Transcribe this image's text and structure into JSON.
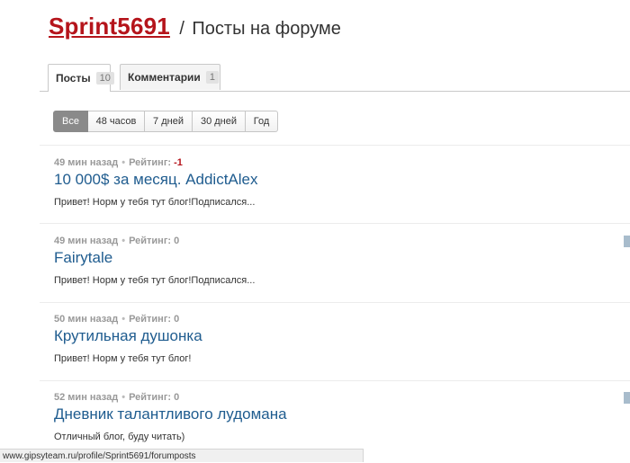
{
  "header": {
    "username": "Sprint5691",
    "separator": "/",
    "title": "Посты на форуме"
  },
  "tabs": [
    {
      "label": "Посты",
      "count": "10",
      "active": true
    },
    {
      "label": "Комментарии",
      "count": "1",
      "active": false
    }
  ],
  "filters": [
    {
      "label": "Все",
      "active": true
    },
    {
      "label": "48 часов",
      "active": false
    },
    {
      "label": "7 дней",
      "active": false
    },
    {
      "label": "30 дней",
      "active": false
    },
    {
      "label": "Год",
      "active": false
    }
  ],
  "rating_label": "Рейтинг:",
  "posts": [
    {
      "time": "49 мин назад",
      "rating": "-1",
      "title": "10 000$ за месяц. AddictAlex",
      "excerpt": "Привет! Норм у тебя тут блог!Подписался..."
    },
    {
      "time": "49 мин назад",
      "rating": "0",
      "title": "Fairytale",
      "excerpt": "Привет! Норм у тебя тут блог!Подписался..."
    },
    {
      "time": "50 мин назад",
      "rating": "0",
      "title": "Крутильная душонка",
      "excerpt": "Привет! Норм у тебя тут блог!"
    },
    {
      "time": "52 мин назад",
      "rating": "0",
      "title": "Дневник талантливого лудомана",
      "excerpt": "Отличный блог, буду читать)"
    }
  ],
  "statusbar": {
    "url": "www.gipsyteam.ru/profile/Sprint5691/forumposts"
  },
  "colors": {
    "username": "#b5141b",
    "post_title": "#1f5c8f",
    "negative_rating": "#b5141b",
    "active_filter": "#8a8a8a"
  }
}
